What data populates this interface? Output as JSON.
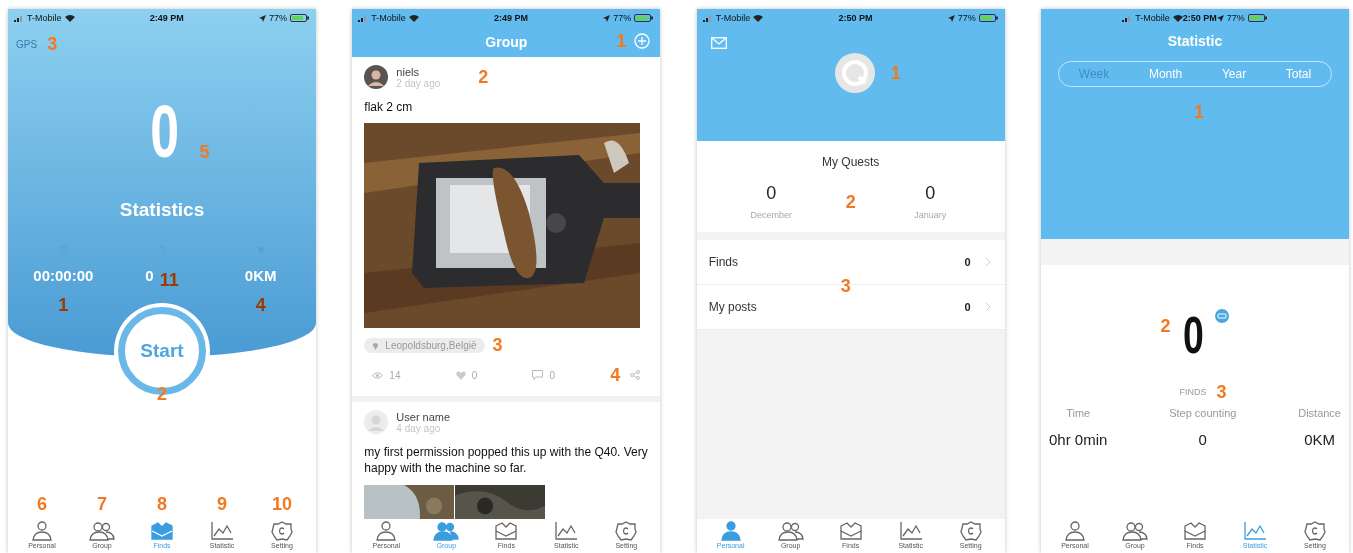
{
  "screens": [
    {
      "kind": "tracker",
      "status_bar": {
        "carrier": "T-Mobile",
        "time": "2:49 PM",
        "battery": "77%"
      },
      "gps": {
        "label": "GPS",
        "marker": "3"
      },
      "count": {
        "value": "0",
        "marker": "5"
      },
      "title": "Statistics",
      "stats": [
        {
          "kind": "time",
          "value": "00:00:00",
          "marker": "1"
        },
        {
          "kind": "steps",
          "value": "0",
          "marker": "11"
        },
        {
          "kind": "distance",
          "value": "0KM",
          "marker": "4"
        }
      ],
      "start_button": {
        "label": "Start",
        "marker": "2"
      },
      "tabs": [
        {
          "kind": "person",
          "label": "Personal",
          "selected": false,
          "marker": "6"
        },
        {
          "kind": "group",
          "label": "Group",
          "selected": false,
          "marker": "7"
        },
        {
          "kind": "finds",
          "label": "Finds",
          "selected": true,
          "marker": "8"
        },
        {
          "kind": "chart",
          "label": "Statistic",
          "selected": false,
          "marker": "9"
        },
        {
          "kind": "gear",
          "label": "Setting",
          "selected": false,
          "marker": "10"
        }
      ]
    },
    {
      "kind": "feed",
      "status_bar": {
        "carrier": "T-Mobile",
        "time": "2:49 PM",
        "battery": "77%"
      },
      "title": "Group",
      "add_marker": "1",
      "posts": [
        {
          "author": "niels",
          "time": "2 day ago",
          "marker": "2",
          "text": "flak 2 cm",
          "location": "Leopoldsburg,België",
          "location_marker": "3",
          "views": "14",
          "likes": "0",
          "comments": "0",
          "actions_marker": "4"
        },
        {
          "author": "User name",
          "time": "4 day ago",
          "text": "my first permission popped this up with the Q40. Very happy with the machine so far."
        }
      ],
      "tabs": [
        {
          "kind": "person",
          "label": "Personal",
          "selected": false
        },
        {
          "kind": "group",
          "label": "Group",
          "selected": true
        },
        {
          "kind": "finds",
          "label": "Finds",
          "selected": false
        },
        {
          "kind": "chart",
          "label": "Statistic",
          "selected": false
        },
        {
          "kind": "gear",
          "label": "Setting",
          "selected": false
        }
      ]
    },
    {
      "kind": "profile",
      "status_bar": {
        "carrier": "T-Mobile",
        "time": "2:50 PM",
        "battery": "77%"
      },
      "avatar_marker": "1",
      "quests_title": "My Quests",
      "quests_marker": "2",
      "quests": [
        {
          "value": "0",
          "label": "December"
        },
        {
          "value": "0",
          "label": "January"
        }
      ],
      "rows_marker": "3",
      "rows": [
        {
          "label": "Finds",
          "value": "0"
        },
        {
          "label": "My posts",
          "value": "0"
        }
      ],
      "tabs": [
        {
          "kind": "person",
          "label": "Personal",
          "selected": true
        },
        {
          "kind": "group",
          "label": "Group",
          "selected": false
        },
        {
          "kind": "finds",
          "label": "Finds",
          "selected": false
        },
        {
          "kind": "chart",
          "label": "Statistic",
          "selected": false
        },
        {
          "kind": "gear",
          "label": "Setting",
          "selected": false
        }
      ]
    },
    {
      "kind": "statistic",
      "status_bar": {
        "carrier": "T-Mobile",
        "time": "2:50 PM",
        "battery": "77%"
      },
      "title": "Statistic",
      "periods": [
        {
          "label": "Week",
          "selected": true
        },
        {
          "label": "Month",
          "selected": false
        },
        {
          "label": "Year",
          "selected": false
        },
        {
          "label": "Total",
          "selected": false
        }
      ],
      "header_marker": "1",
      "finds": {
        "value": "0",
        "marker": "2",
        "label": "FINDS",
        "label_marker": "3"
      },
      "metrics": [
        {
          "label": "Time",
          "value": "0hr 0min"
        },
        {
          "label": "Step counting",
          "value": "0"
        },
        {
          "label": "Distance",
          "value": "0KM"
        }
      ],
      "tabs": [
        {
          "kind": "person",
          "label": "Personal",
          "selected": false
        },
        {
          "kind": "group",
          "label": "Group",
          "selected": false
        },
        {
          "kind": "finds",
          "label": "Finds",
          "selected": false
        },
        {
          "kind": "chart",
          "label": "Statistic",
          "selected": true
        },
        {
          "kind": "gear",
          "label": "Setting",
          "selected": false
        }
      ]
    }
  ]
}
